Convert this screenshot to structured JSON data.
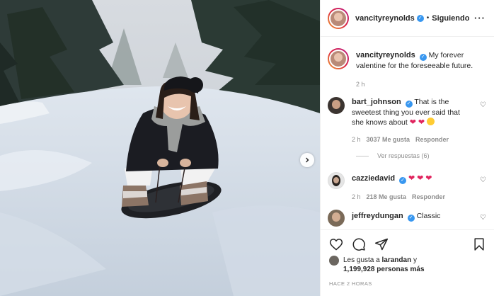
{
  "post": {
    "author": "vancityreynolds",
    "follow_status": "Siguiendo",
    "caption": "My forever valentine for the foreseeable future.",
    "caption_time": "2 h"
  },
  "comments": [
    {
      "user": "bart_johnson",
      "text": "That is the sweetest thing you ever said that she knows about",
      "time": "2 h",
      "likes": "3037 Me gusta",
      "reply": "Responder",
      "view_replies": "Ver respuestas (6)"
    },
    {
      "user": "cazziedavid",
      "time": "2 h",
      "likes": "218 Me gusta",
      "reply": "Responder"
    },
    {
      "user": "jeffreydungan",
      "text": "Classic"
    }
  ],
  "likes_summary": {
    "line1_prefix": "Les gusta a",
    "line1_user": "larandan",
    "line1_suffix": "y",
    "line2_count": "1,199,928",
    "line2_suffix": "personas más"
  },
  "timestamp": "HACE 2 HORAS",
  "icons": {
    "more": "more-options-icon",
    "next": "chevron-right-icon",
    "like": "heart-icon",
    "comment": "comment-icon",
    "share": "send-icon",
    "save": "bookmark-icon"
  }
}
